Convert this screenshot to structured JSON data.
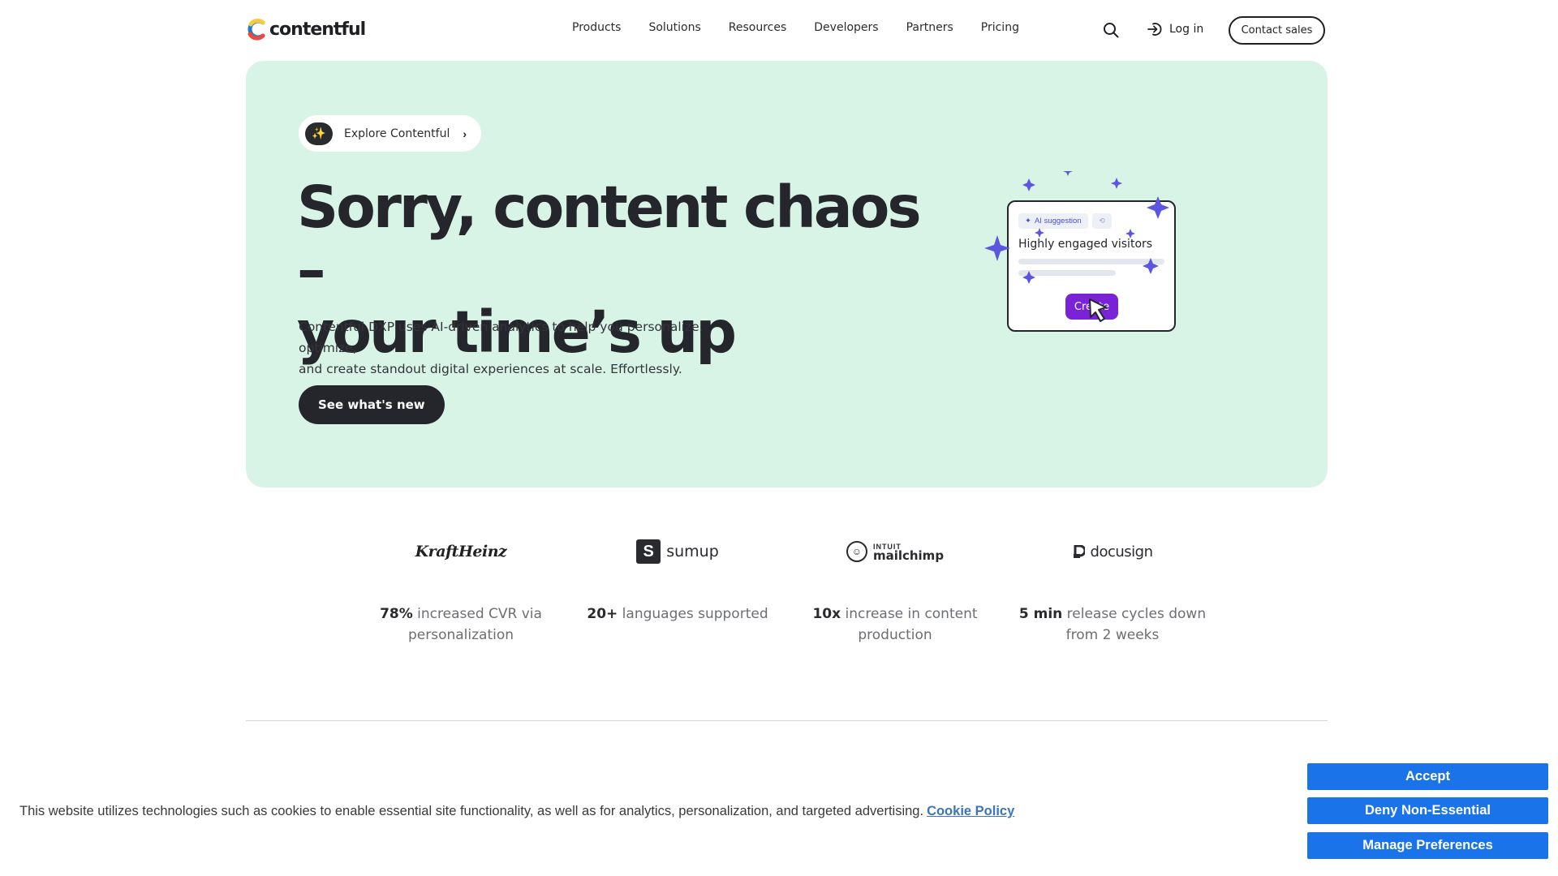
{
  "header": {
    "logo_text": "contentful",
    "nav": [
      "Products",
      "Solutions",
      "Resources",
      "Developers",
      "Partners",
      "Pricing"
    ],
    "search_icon": "search-icon",
    "login_label": "Log in",
    "contact_label": "Contact sales"
  },
  "hero": {
    "explore_label": "Explore Contentful",
    "title_line1": "Sorry, content chaos –",
    "title_line2": "your time’s up",
    "subtitle_line1": "Contentful DXP uses AI-driven analytics to help you personalize, optimize,",
    "subtitle_line2": "and create standout digital experiences at scale. Effortlessly.",
    "cta_label": "See what's new",
    "background_color": "#d7f4e6",
    "illustration": {
      "chip_label": "AI suggestion",
      "card_title": "Highly engaged visitors",
      "create_label": "Create",
      "accent_color": "#7a23d6",
      "sparkle_color": "#5b55e0"
    }
  },
  "stats": [
    {
      "brand": "KraftHeinz",
      "strong": "78%",
      "rest": " increased CVR via personalization"
    },
    {
      "brand": "sumup",
      "strong": "20+",
      "rest": " languages supported"
    },
    {
      "brand_top": "INTUIT",
      "brand": "mailchimp",
      "strong": "10x",
      "rest": " increase in content production"
    },
    {
      "brand": "docusign",
      "strong": "5 min",
      "rest": " release cycles down from 2 weeks"
    }
  ],
  "cookie": {
    "text": "This website utilizes technologies such as cookies to enable essential site functionality, as well as for analytics, personalization, and targeted advertising.",
    "link": "Cookie Policy",
    "accept": "Accept",
    "deny": "Deny Non-Essential",
    "manage": "Manage Preferences",
    "button_color": "#1a73e8"
  }
}
